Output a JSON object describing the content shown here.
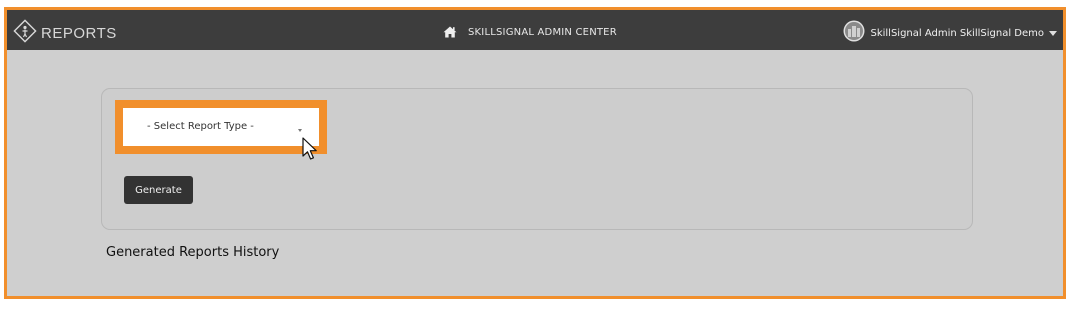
{
  "topbar": {
    "brand_label": "REPORTS",
    "center_title": "SKILLSIGNAL ADMIN CENTER",
    "user_label": "SkillSignal Admin SkillSignal Demo",
    "icons": {
      "brand": "compass-person-icon",
      "center": "home-icon",
      "user": "avatar-icon",
      "menu": "caret-down-icon"
    }
  },
  "report_form": {
    "select_placeholder": "- Select Report Type -",
    "generate_label": "Generate"
  },
  "history": {
    "heading": "Generated Reports History"
  },
  "colors": {
    "highlight": "#f18f2c",
    "topbar_bg": "#3d3d3d",
    "page_bg": "#cfcfcf",
    "button_bg": "#333333"
  }
}
